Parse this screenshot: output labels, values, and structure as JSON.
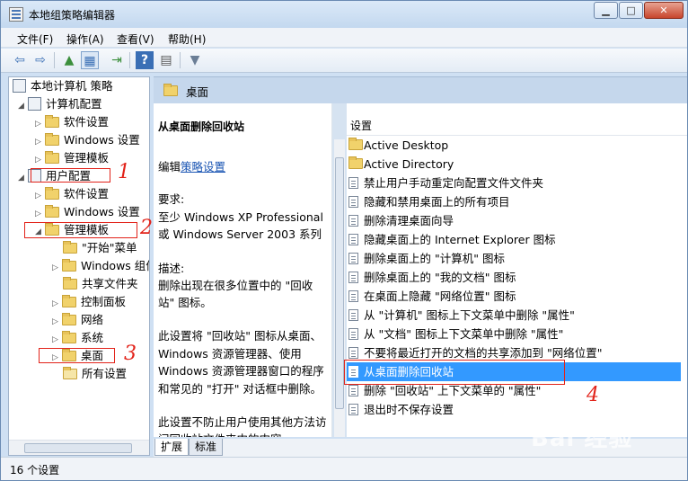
{
  "window": {
    "title": "本地组策略编辑器"
  },
  "menu": [
    "文件(F)",
    "操作(A)",
    "查看(V)",
    "帮助(H)"
  ],
  "toolbar": [
    {
      "icon": "back-arrow-icon",
      "glyph": "⇦"
    },
    {
      "icon": "forward-arrow-icon",
      "glyph": "⇨"
    },
    {
      "icon": "up-folder-icon",
      "glyph": "▲"
    },
    {
      "icon": "show-hide-tree-icon",
      "glyph": "▦"
    },
    {
      "icon": "export-list-icon",
      "glyph": "⇥"
    },
    {
      "icon": "help-icon",
      "glyph": "?"
    },
    {
      "icon": "properties-icon",
      "glyph": "▤"
    },
    {
      "icon": "filter-icon",
      "glyph": "▼"
    }
  ],
  "tree": {
    "root": "本地计算机 策略",
    "computer_config": "计算机配置",
    "software_settings": "软件设置",
    "windows_settings": "Windows 设置",
    "admin_templates": "管理模板",
    "user_config": "用户配置",
    "user_software_settings": "软件设置",
    "user_windows_settings": "Windows 设置",
    "user_admin_templates": "管理模板",
    "start_menu": "\"开始\"菜单",
    "windows_components": "Windows 组件",
    "shared_folders": "共享文件夹",
    "control_panel": "控制面板",
    "network": "网络",
    "system": "系统",
    "desktop": "桌面",
    "all_settings": "所有设置"
  },
  "detail": {
    "header": "桌面",
    "title": "从桌面删除回收站",
    "edit_prefix": "编辑",
    "edit_link": "策略设置",
    "lines": [
      "要求:",
      "至少 Windows XP Professional",
      "或 Windows Server 2003 系列",
      "描述:",
      "删除出现在很多位置中的 \"回收",
      "站\" 图标。",
      "此设置将 \"回收站\" 图标从桌面、",
      "Windows 资源管理器、使用",
      "Windows 资源管理器窗口的程序",
      "和常见的 \"打开\" 对话框中删除。",
      "此设置不防止用户使用其他方法访",
      "问回收站文件夹中的内容"
    ]
  },
  "list": {
    "header": "设置",
    "items": [
      {
        "label": "Active Desktop",
        "kind": "folder"
      },
      {
        "label": "Active Directory",
        "kind": "folder"
      },
      {
        "label": "禁止用户手动重定向配置文件文件夹",
        "kind": "setting"
      },
      {
        "label": "隐藏和禁用桌面上的所有项目",
        "kind": "setting"
      },
      {
        "label": "删除清理桌面向导",
        "kind": "setting"
      },
      {
        "label": "隐藏桌面上的 Internet Explorer 图标",
        "kind": "setting"
      },
      {
        "label": "删除桌面上的 \"计算机\" 图标",
        "kind": "setting"
      },
      {
        "label": "删除桌面上的 \"我的文档\" 图标",
        "kind": "setting"
      },
      {
        "label": "在桌面上隐藏 \"网络位置\" 图标",
        "kind": "setting"
      },
      {
        "label": "从 \"计算机\" 图标上下文菜单中删除 \"属性\"",
        "kind": "setting"
      },
      {
        "label": "从 \"文档\" 图标上下文菜单中删除 \"属性\"",
        "kind": "setting"
      },
      {
        "label": "不要将最近打开的文档的共享添加到 \"网络位置\"",
        "kind": "setting"
      },
      {
        "label": "从桌面删除回收站",
        "kind": "setting",
        "selected": true
      },
      {
        "label": "删除 \"回收站\" 上下文菜单的 \"属性\"",
        "kind": "setting"
      },
      {
        "label": "退出时不保存设置",
        "kind": "setting"
      }
    ]
  },
  "tabs": [
    "扩展",
    "标准"
  ],
  "status": "16 个设置",
  "annotations": [
    "1",
    "2",
    "3",
    "4"
  ],
  "watermark": "Bai 经验",
  "colors": {
    "selection": "#3399ff",
    "annotation": "#e2231a",
    "header": "#c5d7ec"
  }
}
